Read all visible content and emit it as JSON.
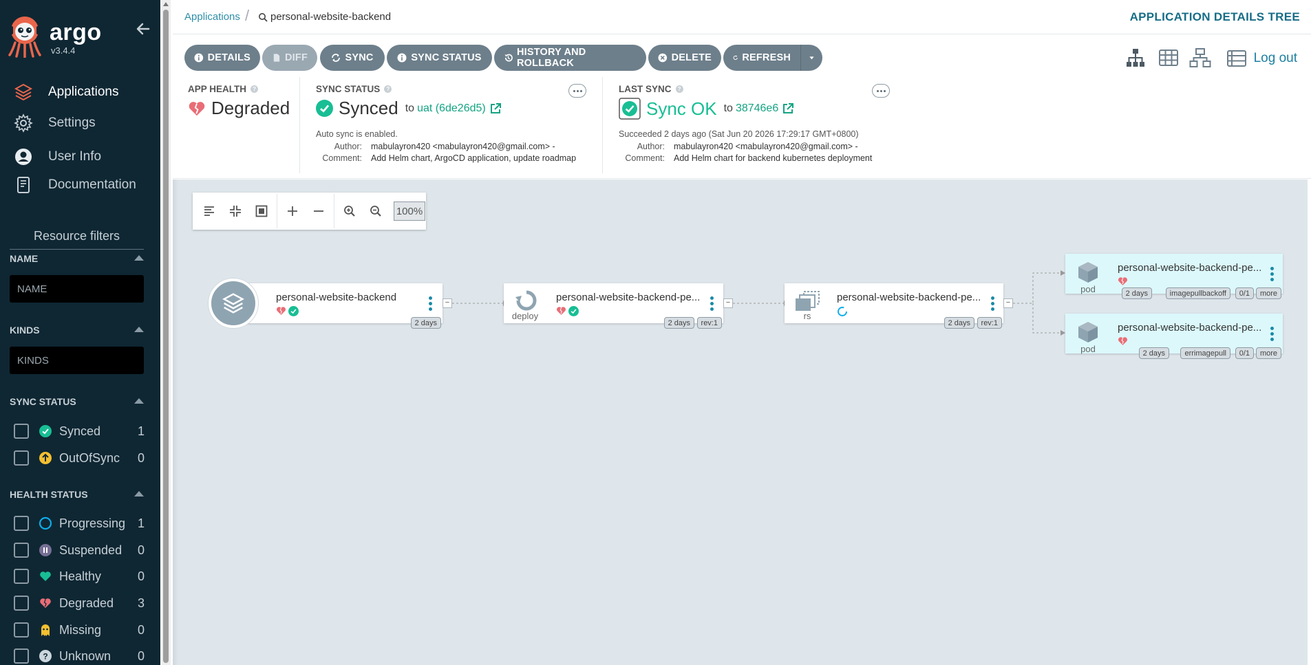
{
  "app": {
    "brand": "argo",
    "version": "v3.4.4"
  },
  "nav": [
    {
      "label": "Applications",
      "icon": "layers-icon",
      "active": true
    },
    {
      "label": "Settings",
      "icon": "gear-icon"
    },
    {
      "label": "User Info",
      "icon": "user-icon"
    },
    {
      "label": "Documentation",
      "icon": "book-icon"
    }
  ],
  "filters": {
    "title": "Resource filters",
    "name": {
      "label": "NAME",
      "placeholder": "NAME"
    },
    "kinds": {
      "label": "KINDS",
      "placeholder": "KINDS"
    },
    "sync_status": {
      "label": "SYNC STATUS",
      "items": [
        {
          "label": "Synced",
          "count": "1",
          "icon": "synced-icon",
          "color": "#18be94"
        },
        {
          "label": "OutOfSync",
          "count": "0",
          "icon": "outofsync-icon",
          "color": "#f4c030"
        }
      ]
    },
    "health_status": {
      "label": "HEALTH STATUS",
      "items": [
        {
          "label": "Progressing",
          "count": "1",
          "icon": "progressing-icon",
          "color": "#0dadea"
        },
        {
          "label": "Suspended",
          "count": "0",
          "icon": "suspended-icon",
          "color": "#766f94"
        },
        {
          "label": "Healthy",
          "count": "0",
          "icon": "healthy-icon",
          "color": "#18be94"
        },
        {
          "label": "Degraded",
          "count": "3",
          "icon": "degraded-icon",
          "color": "#e96d76"
        },
        {
          "label": "Missing",
          "count": "0",
          "icon": "missing-icon",
          "color": "#f4c030"
        },
        {
          "label": "Unknown",
          "count": "0",
          "icon": "unknown-icon",
          "color": "#ccd6dd"
        }
      ]
    }
  },
  "breadcrumb": {
    "root": "Applications",
    "current": "personal-website-backend"
  },
  "view_title": "APPLICATION DETAILS TREE",
  "toolbar": {
    "details": "DETAILS",
    "diff": "DIFF",
    "sync": "SYNC",
    "sync_status": "SYNC STATUS",
    "history": "HISTORY AND ROLLBACK",
    "delete": "DELETE",
    "refresh": "REFRESH",
    "logout": "Log out"
  },
  "status": {
    "app_health": {
      "label": "APP HEALTH",
      "value": "Degraded"
    },
    "sync_status": {
      "label": "SYNC STATUS",
      "value": "Synced",
      "to": "to",
      "revision": "uat (6de26d5)",
      "auto_sync": "Auto sync is enabled.",
      "author_key": "Author:",
      "author": "mabulayron420 <mabulayron420@gmail.com> -",
      "comment_key": "Comment:",
      "comment": "Add Helm chart, ArgoCD application, update roadmap"
    },
    "last_sync": {
      "label": "LAST SYNC",
      "value": "Sync OK",
      "to": "to",
      "revision": "38746e6",
      "succeeded": "Succeeded 2 days ago (Sat Jun 20 2026 17:29:17 GMT+0800)",
      "author_key": "Author:",
      "author": "mabulayron420 <mabulayron420@gmail.com> -",
      "comment_key": "Comment:",
      "comment": "Add Helm chart for backend kubernetes deployment"
    }
  },
  "graph": {
    "zoom": "100%",
    "nodes": {
      "app": {
        "name": "personal-website-backend",
        "age": "2 days"
      },
      "deploy": {
        "name": "personal-website-backend-pe...",
        "kind": "deploy",
        "age": "2 days",
        "rev": "rev:1"
      },
      "rs": {
        "name": "personal-website-backend-pe...",
        "kind": "rs",
        "age": "2 days",
        "rev": "rev:1"
      },
      "pod1": {
        "name": "personal-website-backend-pe...",
        "kind": "pod",
        "age": "2 days",
        "status": "imagepullbackoff",
        "ready": "0/1",
        "more": "more"
      },
      "pod2": {
        "name": "personal-website-backend-pe...",
        "kind": "pod",
        "age": "2 days",
        "status": "errimagepull",
        "ready": "0/1",
        "more": "more"
      }
    }
  }
}
